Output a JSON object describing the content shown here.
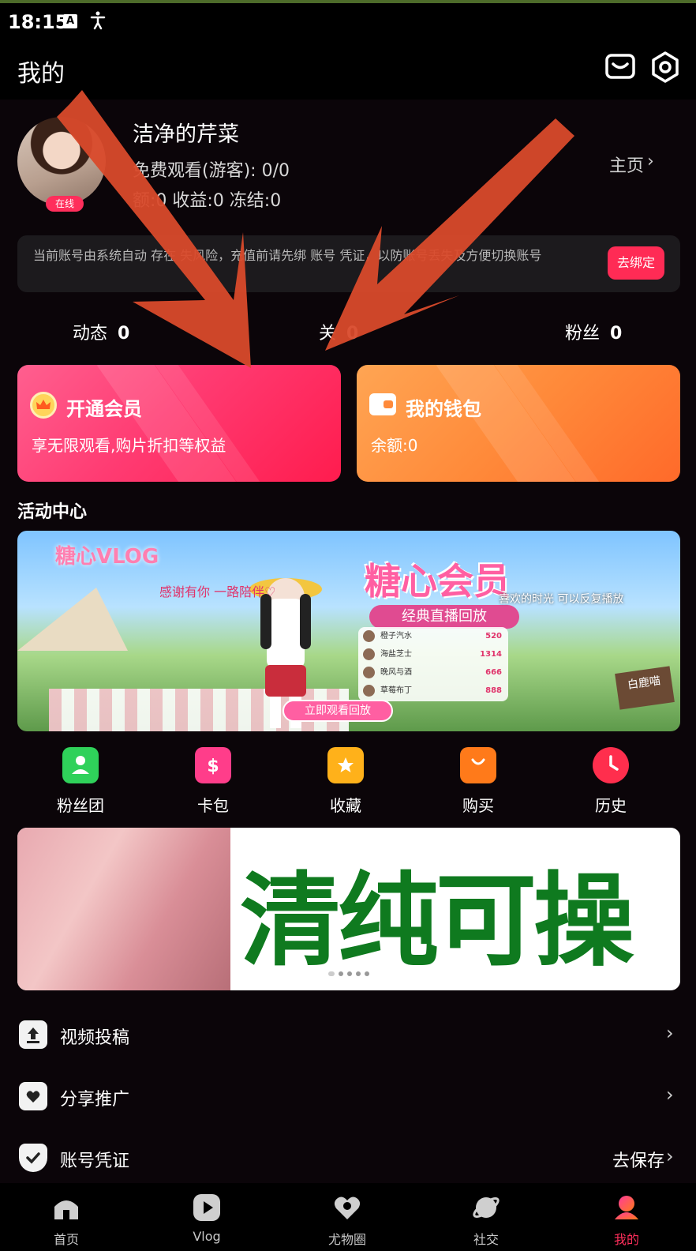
{
  "status_bar": {
    "time": "18:15",
    "keyboard_icon_letter": "A"
  },
  "header": {
    "title": "我的"
  },
  "profile": {
    "username": "洁净的芹菜",
    "online_badge": "在线",
    "watch_line": "免费观看(游客): 0/0",
    "balance_line": "额:0 收益:0 冻结:0",
    "home_link": "主页",
    "home_chevron": "›"
  },
  "notice": {
    "text": "当前账号由系统自动 存在 失风险，充值前请先绑 账号 凭证，以防账号丢失及方便切换账号",
    "button": "去绑定"
  },
  "stats": [
    {
      "label": "动态",
      "value": "0"
    },
    {
      "label": "关",
      "value": "0"
    },
    {
      "label": "粉丝",
      "value": "0"
    }
  ],
  "vip_card": {
    "title": "开通会员",
    "subtitle": "享无限观看,购片折扣等权益"
  },
  "wallet_card": {
    "title": "我的钱包",
    "subtitle": "余额:0"
  },
  "activity": {
    "title": "活动中心",
    "banner": {
      "logo": "糖心VLOG",
      "thanks": "感谢有你 一路陪伴♡",
      "title": "糖心会员",
      "subtitle": "经典直播回放",
      "right_text": "喜欢的时光 可以反复播放",
      "list": [
        {
          "name": "橙子汽水",
          "count": "520"
        },
        {
          "name": "海盐芝士",
          "count": "1314"
        },
        {
          "name": "晚风与酒",
          "count": "666"
        },
        {
          "name": "草莓布丁",
          "count": "888"
        }
      ],
      "button": "立即观看回放",
      "sign": "白鹿喵"
    }
  },
  "quick_actions": [
    {
      "label": "粉丝团",
      "icon": "fan-group-icon",
      "color": "#2fd15a"
    },
    {
      "label": "卡包",
      "icon": "card-wallet-icon",
      "color": "#ff3d8a"
    },
    {
      "label": "收藏",
      "icon": "favorites-icon",
      "color": "#ffb11a"
    },
    {
      "label": "购买",
      "icon": "shopping-bag-icon",
      "color": "#ff7a1a"
    },
    {
      "label": "历史",
      "icon": "history-clock-icon",
      "color": "#ff2e4d"
    }
  ],
  "promo_banner": {
    "text": "清纯可操"
  },
  "menu": [
    {
      "label": "视频投稿",
      "icon": "upload-icon",
      "action": ""
    },
    {
      "label": "分享推广",
      "icon": "share-icon",
      "action": ""
    },
    {
      "label": "账号凭证",
      "icon": "shield-icon",
      "action": "去保存"
    }
  ],
  "tabs": [
    {
      "label": "首页",
      "icon": "home-icon"
    },
    {
      "label": "Vlog",
      "icon": "play-icon"
    },
    {
      "label": "尤物圈",
      "icon": "heart-icon"
    },
    {
      "label": "社交",
      "icon": "planet-icon"
    },
    {
      "label": "我的",
      "icon": "profile-icon",
      "active": true
    }
  ],
  "colors": {
    "accent": "#ff2e5b",
    "annotation_arrow": "#d94a2b"
  }
}
